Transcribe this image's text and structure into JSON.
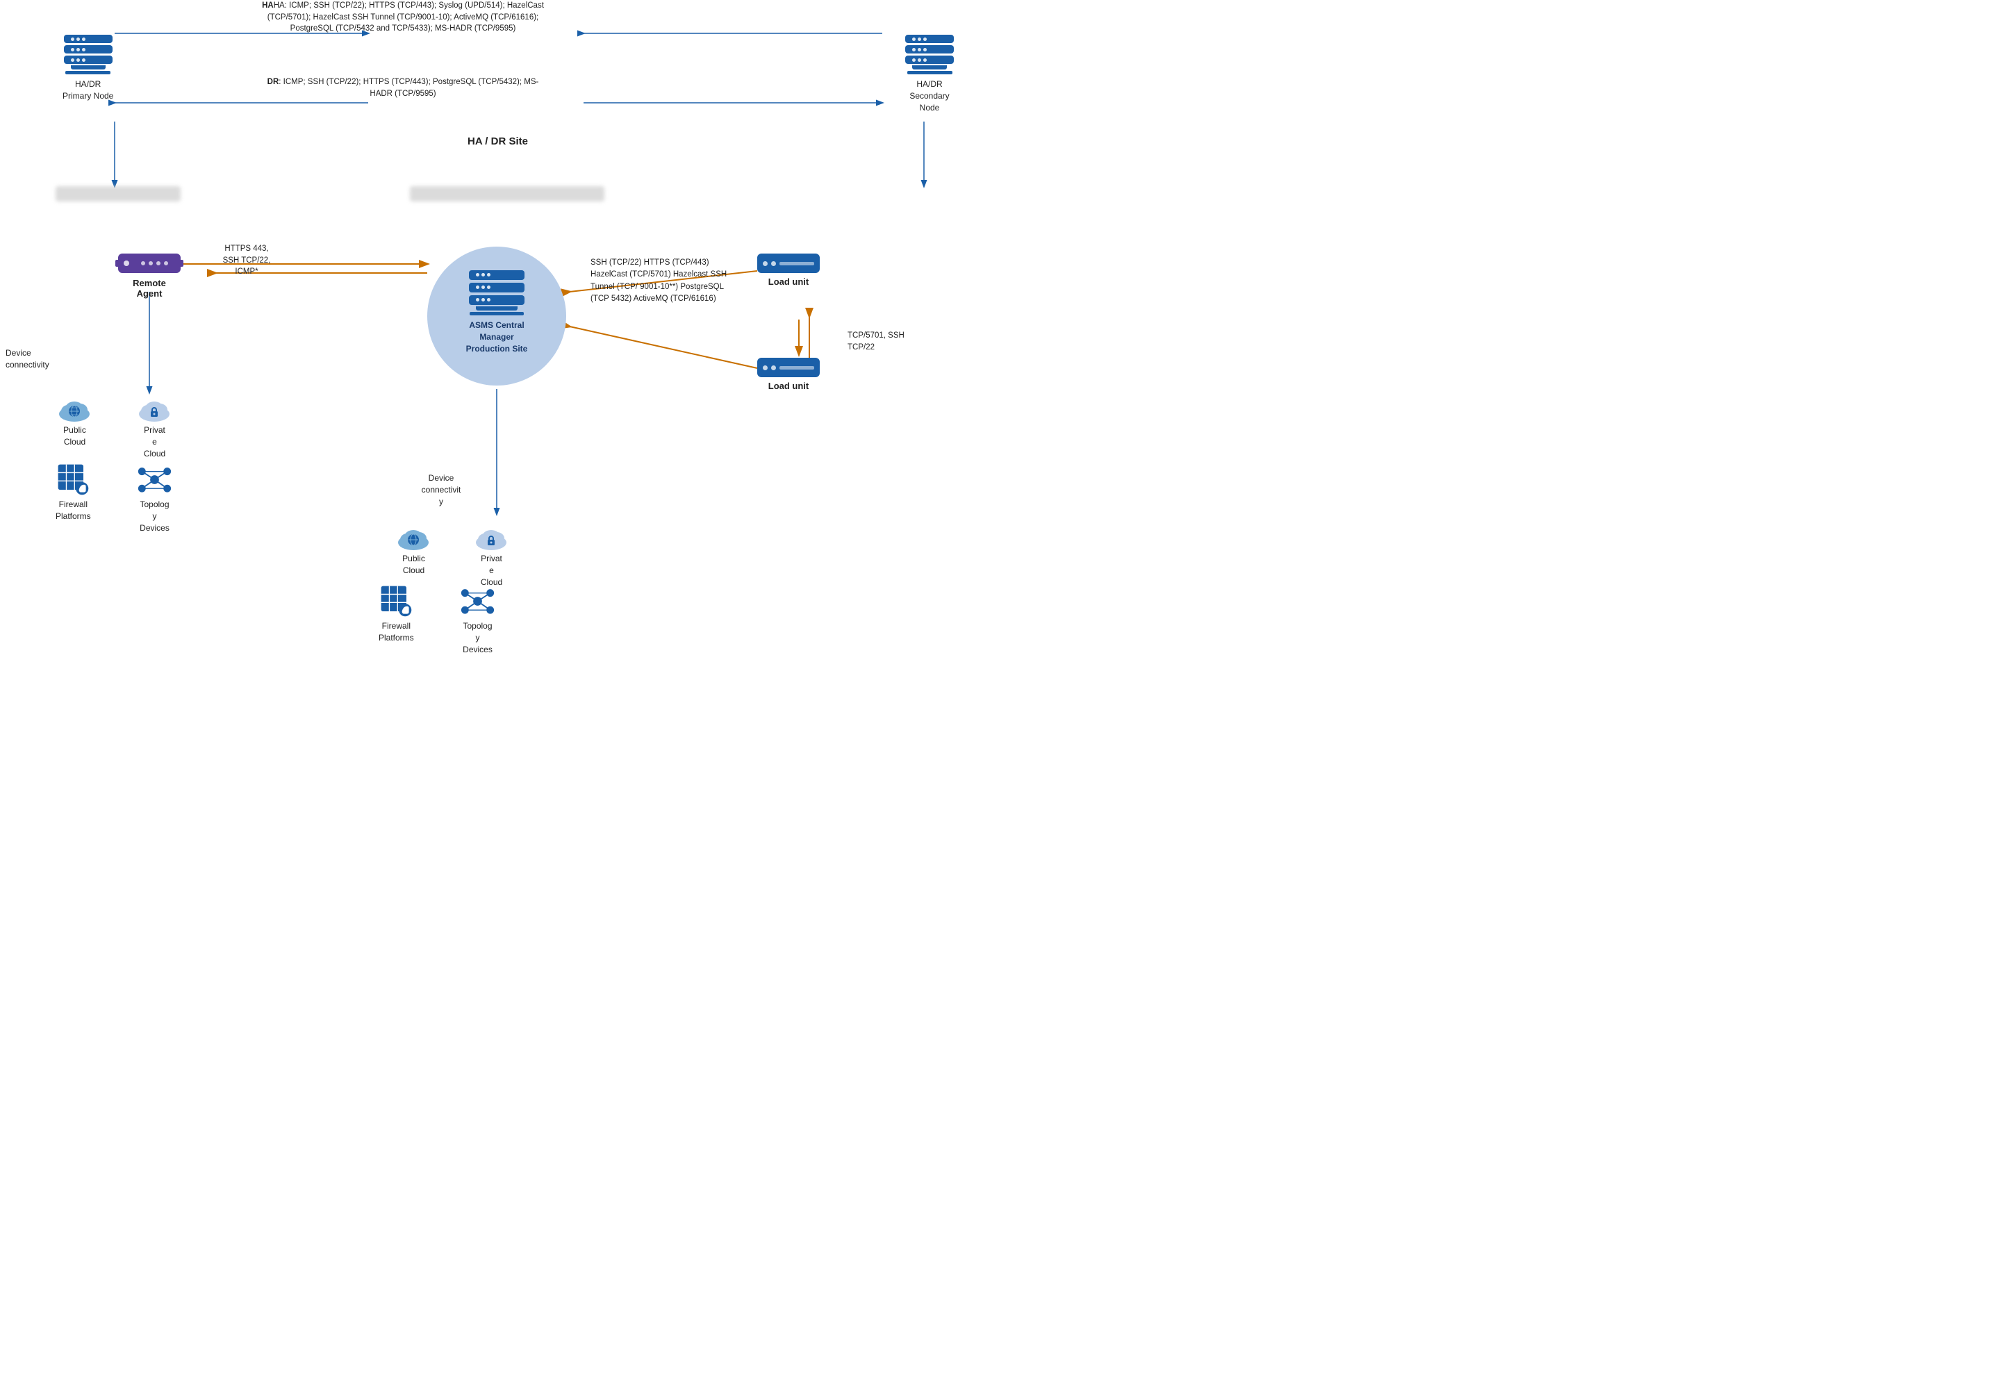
{
  "ha_dr": {
    "site_label": "HA / DR Site",
    "ha_annotation": "HA: ICMP; SSH (TCP/22); HTTPS (TCP/443); Syslog (UPD/514); HazelCast (TCP/5701); HazelCast SSH Tunnel (TCP/9001-10); ActiveMQ (TCP/61616); PostgreSQL (TCP/5432 and TCP/5433); MS-HADR (TCP/9595)",
    "dr_annotation": "DR: ICMP; SSH (TCP/22); HTTPS (TCP/443); PostgreSQL (TCP/5432); MS-HADR (TCP/9595)",
    "primary_label": "HA/DR\nPrimary Node",
    "secondary_label": "HA/DR\nSecondary\nNode"
  },
  "center": {
    "label": "ASMS Central\nManager\nProduction Site"
  },
  "remote_agent": {
    "label": "Remote\nAgent",
    "annotation": "HTTPS\n443,\nSSH\nTCP/22,\nICMP*"
  },
  "load_units": {
    "unit1_label": "Load unit",
    "unit2_label": "Load unit",
    "annotation": "SSH (TCP/22)\nHTTPS (TCP/443)\nHazelCast (TCP/5701)\nHazelcast SSH Tunnel\n(TCP/ 9001-10**)\nPostgreSQL (TCP 5432)\nActiveMQ (TCP/61616)",
    "side_annotation": "TCP/5701,\nSSH TCP/22"
  },
  "device_connectivity": {
    "label": "Device\nconnectivity",
    "label2": "Device\nconnectivit\ny"
  },
  "left_devices": {
    "public_cloud": "Public\nCloud",
    "private_cloud": "Privat\ne\nCloud",
    "firewall": "Firewall\nPlatforms",
    "topology": "Topolog\ny\nDevices"
  },
  "bottom_devices": {
    "public_cloud": "Public\nCloud",
    "private_cloud": "Privat\ne\nCloud",
    "firewall": "Firewall\nPlatforms",
    "topology": "Topolog\ny\nDevices"
  }
}
